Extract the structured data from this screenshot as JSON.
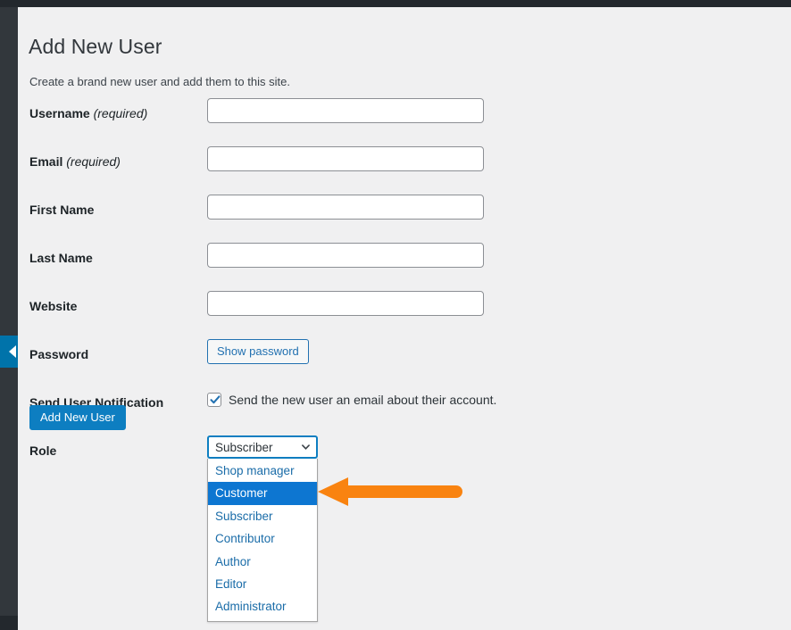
{
  "colors": {
    "page_background": "#f0f0f1",
    "admin_chrome_dark": "#32373c",
    "admin_chrome_darker": "#23282d",
    "accent_blue": "#0d7ec1",
    "link_blue": "#2271b1",
    "option_highlight_blue": "#0d76d1",
    "annotation_orange": "#f98310",
    "text_primary": "#1d2327"
  },
  "sidebar": {
    "collapse_tab_label": "collapse-menu"
  },
  "header": {
    "title": "Add New User",
    "subtitle": "Create a brand new user and add them to this site."
  },
  "form": {
    "fields": [
      {
        "label": "Username",
        "required_note": "(required)",
        "value": "",
        "placeholder": ""
      },
      {
        "label": "Email",
        "required_note": "(required)",
        "value": "",
        "placeholder": ""
      },
      {
        "label": "First Name",
        "required_note": "",
        "value": "",
        "placeholder": ""
      },
      {
        "label": "Last Name",
        "required_note": "",
        "value": "",
        "placeholder": ""
      },
      {
        "label": "Website",
        "required_note": "",
        "value": "",
        "placeholder": ""
      }
    ],
    "password": {
      "label": "Password",
      "button_label": "Show password"
    },
    "notification": {
      "label": "Send User Notification",
      "checkbox_checked": true,
      "checkbox_text": "Send the new user an email about their account."
    },
    "role": {
      "label": "Role",
      "selected_value": "Subscriber",
      "highlighted_option": "Customer",
      "options": [
        "Shop manager",
        "Customer",
        "Subscriber",
        "Contributor",
        "Author",
        "Editor",
        "Administrator"
      ]
    },
    "submit": {
      "label": "Add New User"
    }
  },
  "annotation": {
    "arrow_color": "#f98310",
    "arrow_direction": "left",
    "points_at": "Customer"
  }
}
